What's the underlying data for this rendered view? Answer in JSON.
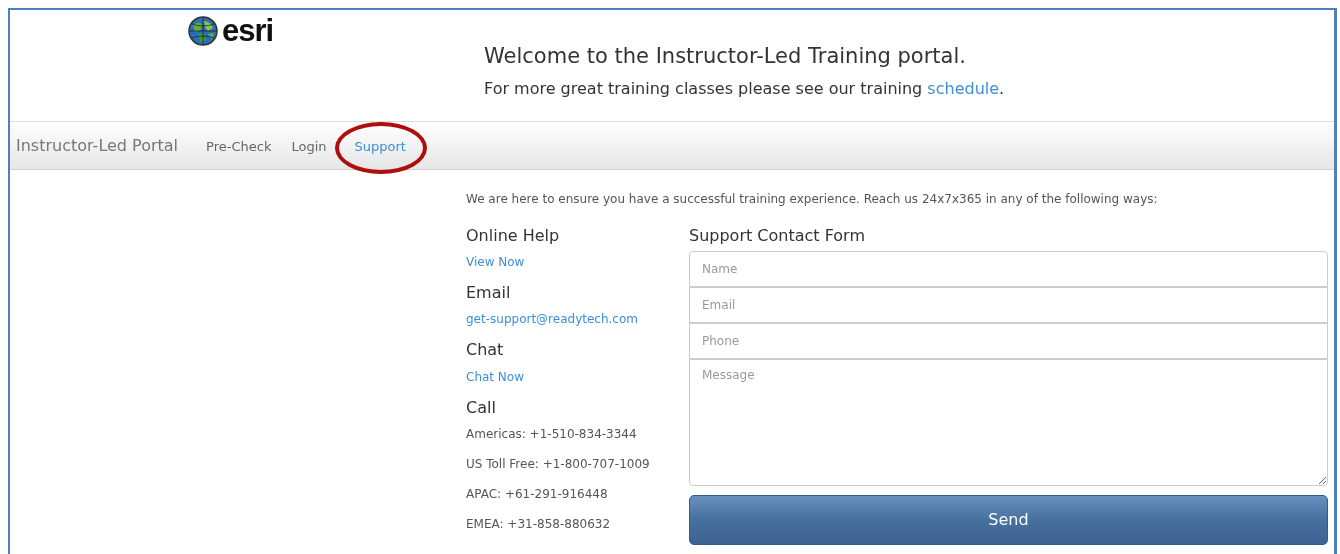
{
  "header": {
    "logo": "esri",
    "title": "Welcome to the Instructor-Led Training portal.",
    "subtitle": "For more great training classes please see our training ",
    "subtitle_link": "schedule",
    "subtitle_end": "."
  },
  "navbar": {
    "brand": "Instructor-Led Portal",
    "items": [
      {
        "label": "Pre-Check",
        "selected": false,
        "circled": false
      },
      {
        "label": "Login",
        "selected": false,
        "circled": false
      },
      {
        "label": "Support",
        "selected": true,
        "circled": true
      }
    ]
  },
  "intro": "We are here to ensure you have a successful training experience. Reach us 24x7x365 in any of the following ways:",
  "contacts": [
    {
      "heading": "Online Help",
      "lines": [
        {
          "kind": "link",
          "text": "View Now"
        }
      ]
    },
    {
      "heading": "Email",
      "lines": [
        {
          "kind": "link",
          "text": "get-support@readytech.com"
        }
      ]
    },
    {
      "heading": "Chat",
      "lines": [
        {
          "kind": "link",
          "text": "Chat Now"
        }
      ]
    },
    {
      "heading": "Call",
      "lines": [
        {
          "kind": "text",
          "text": "Americas: +1-510-834-3344"
        },
        {
          "kind": "text",
          "text": "US Toll Free: +1-800-707-1009"
        },
        {
          "kind": "text",
          "text": "APAC: +61-291-916448"
        },
        {
          "kind": "text",
          "text": "EMEA: +31-858-880632"
        }
      ]
    }
  ],
  "form": {
    "title": "Support Contact Form",
    "fields": [
      {
        "kind": "input",
        "placeholder": "Name"
      },
      {
        "kind": "input",
        "placeholder": "Email"
      },
      {
        "kind": "input",
        "placeholder": "Phone"
      },
      {
        "kind": "textarea",
        "placeholder": "Message"
      }
    ],
    "button": "Send"
  }
}
